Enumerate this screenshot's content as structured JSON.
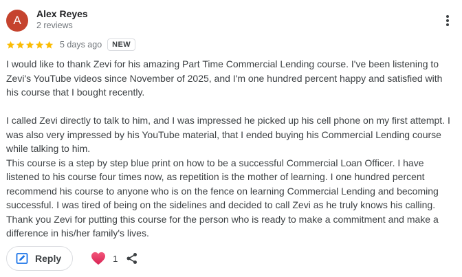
{
  "reviewer": {
    "initial": "A",
    "name": "Alex Reyes",
    "review_count": "2 reviews",
    "avatar_color": "#c5432e"
  },
  "rating": {
    "stars": 5,
    "max_stars": 5,
    "star_color": "#fbbc04",
    "date": "5 days ago",
    "badge": "NEW"
  },
  "review": {
    "paragraph_1": "I would like to thank Zevi for his amazing Part Time Commercial Lending course. I've been listening to Zevi's YouTube videos since November of 2025, and I'm one hundred percent happy and satisfied with his course that I bought recently.",
    "paragraph_2": "I called Zevi directly to talk to him, and I was impressed he picked up his cell phone on my first attempt. I was also very impressed by his YouTube material, that I ended buying his Commercial Lending course while talking to him.",
    "paragraph_3": "This course is a step by step blue print on how to be a successful Commercial Loan Officer. I have listened to his course four times now, as repetition is the mother of learning. I one hundred percent recommend his course to anyone who is on the fence on learning Commercial Lending and becoming successful. I was tired of being on the sidelines and decided to call Zevi as he truly knows his calling. Thank you Zevi for putting this course for the person who is ready to make a commitment and make a difference in his/her family's lives."
  },
  "actions": {
    "reply_label": "Reply",
    "reaction_icon": "heart-icon",
    "reaction_count": "1",
    "share_icon": "share-icon",
    "more_icon": "more-vert-icon"
  }
}
